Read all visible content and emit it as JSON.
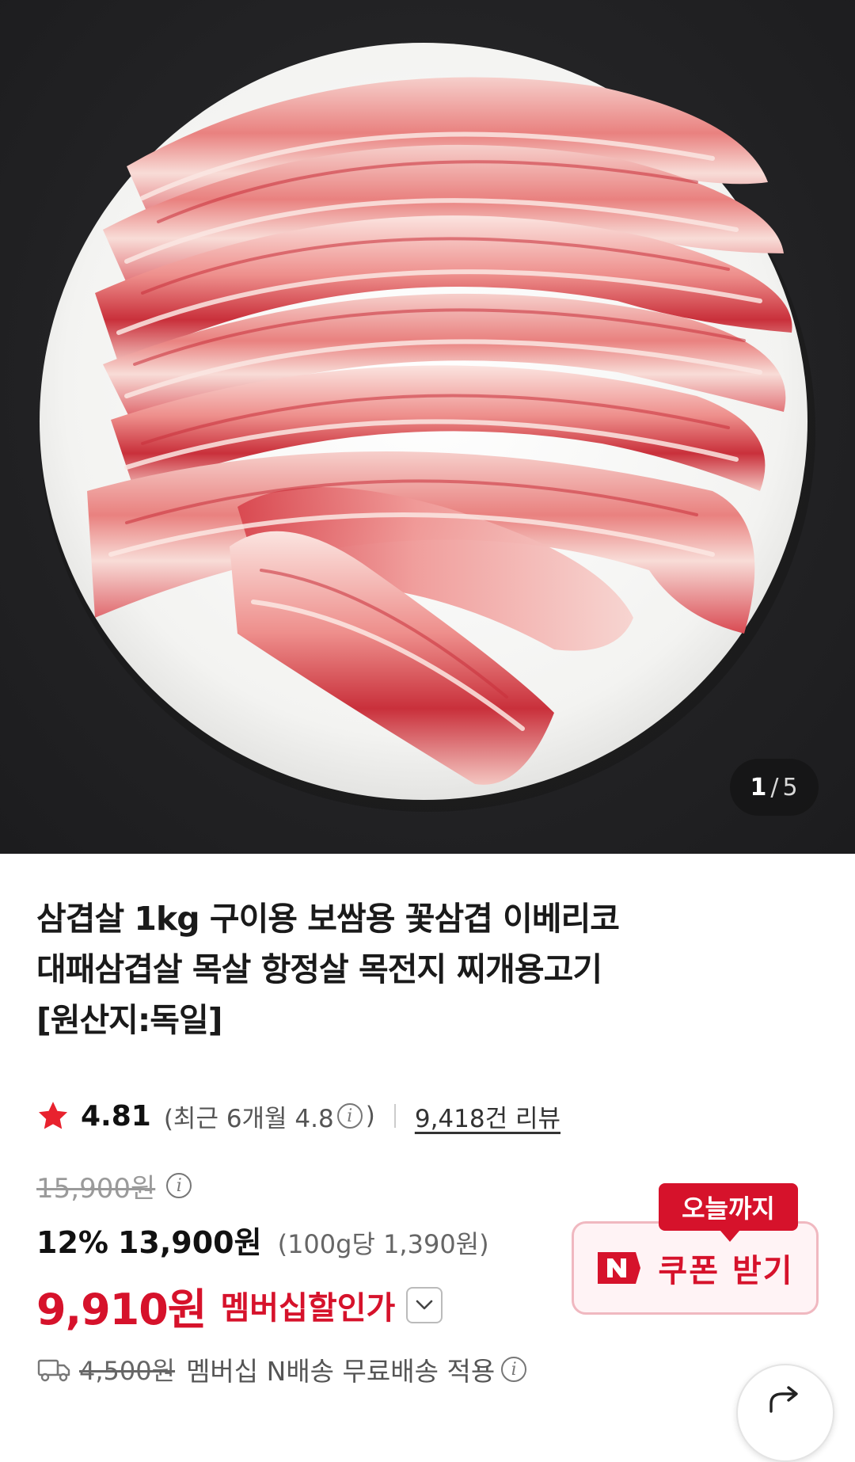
{
  "gallery": {
    "image_alt": "product-photo-pork-belly",
    "current": "1",
    "separator": "/",
    "total": "5"
  },
  "product": {
    "title_lines": [
      "삼겹살 1kg 구이용 보쌈용 꽃삼겹 이베리코",
      "대패삼겹살 목살 항정살 목전지 찌개용고기",
      "[원산지:독일]"
    ]
  },
  "rating": {
    "icon": "star-icon",
    "value": "4.81",
    "recent_prefix": "(최근 6개월 4.8",
    "recent_suffix": ")",
    "review_link": "9,418건 리뷰"
  },
  "price": {
    "original": "15,900원",
    "discount_rate": "12%",
    "sale_price": "13,900원",
    "unit_price": "(100g당 1,390원)",
    "member_price": "9,910원",
    "member_label": "멤버십할인가"
  },
  "shipping": {
    "icon": "truck-icon",
    "original_fee": "4,500원",
    "text": "멤버십 N배송 무료배송 적용"
  },
  "coupon": {
    "tag": "오늘까지",
    "label": "쿠폰 받기",
    "icon": "naver-n-icon"
  },
  "colors": {
    "accent_red": "#d6122b",
    "coupon_bg": "#fff3f5",
    "hero_bg": "#242426"
  }
}
